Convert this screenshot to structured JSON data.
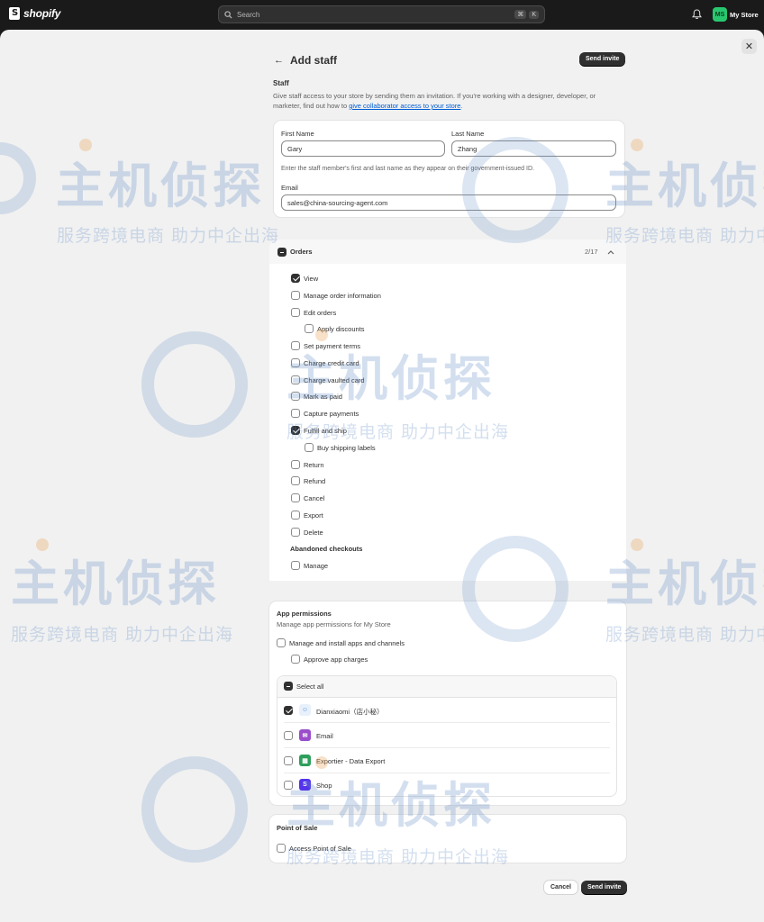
{
  "topbar": {
    "brand": "shopify",
    "search_placeholder": "Search",
    "shortcut_keys": [
      "⌘",
      "K"
    ],
    "avatar_initials": "MS",
    "store_name": "My Store",
    "avatar_color": "#28c76f"
  },
  "header": {
    "title": "Add staff",
    "send_invite": "Send invite"
  },
  "staff": {
    "title": "Staff",
    "desc_prefix": "Give staff access to your store by sending them an invitation. If you're working with a designer, developer, or marketer, find out how to ",
    "desc_link": "give collaborator access to your store",
    "desc_suffix": ".",
    "first_name_label": "First Name",
    "first_name_value": "Gary",
    "last_name_label": "Last Name",
    "last_name_value": "Zhang",
    "name_help": "Enter the staff member's first and last name as they appear on their government-issued ID.",
    "email_label": "Email",
    "email_value": "sales@china-sourcing-agent.com"
  },
  "orders": {
    "title": "Orders",
    "count": "2/17",
    "items": [
      {
        "label": "View",
        "checked": true
      },
      {
        "label": "Manage order information",
        "checked": false
      },
      {
        "label": "Edit orders",
        "checked": false
      },
      {
        "label": "Apply discounts",
        "checked": false
      },
      {
        "label": "Set payment terms",
        "checked": false
      },
      {
        "label": "Charge credit card",
        "checked": false
      },
      {
        "label": "Charge vaulted card",
        "checked": false
      },
      {
        "label": "Mark as paid",
        "checked": false
      },
      {
        "label": "Capture payments",
        "checked": false
      },
      {
        "label": "Fulfill and ship",
        "checked": true
      },
      {
        "label": "Buy shipping labels",
        "checked": false
      },
      {
        "label": "Return",
        "checked": false
      },
      {
        "label": "Refund",
        "checked": false
      },
      {
        "label": "Cancel",
        "checked": false
      },
      {
        "label": "Export",
        "checked": false
      },
      {
        "label": "Delete",
        "checked": false
      }
    ],
    "abandoned_title": "Abandoned checkouts",
    "abandoned_manage": "Manage"
  },
  "app_permissions": {
    "title": "App permissions",
    "subtitle": "Manage app permissions for My Store",
    "manage_install": "Manage and install apps and channels",
    "approve_charges": "Approve app charges",
    "select_all": "Select all",
    "apps": [
      {
        "name": "Dianxiaomi（店小秘）",
        "checked": true,
        "icon_color": "#e8f1fb",
        "icon": "person-icon"
      },
      {
        "name": "Email",
        "checked": false,
        "icon_color": "#9b4dca",
        "icon": "envelope-icon"
      },
      {
        "name": "Exportier - Data Export",
        "checked": false,
        "icon_color": "#2e9e5b",
        "icon": "storefront-icon"
      },
      {
        "name": "Shop",
        "checked": false,
        "icon_color": "#5433eb",
        "icon": "shop-icon"
      }
    ]
  },
  "point_of_sale": {
    "title": "Point of Sale",
    "access": "Access Point of Sale"
  },
  "footer": {
    "cancel": "Cancel",
    "send_invite": "Send invite"
  },
  "watermark": {
    "main": "主机侦探",
    "sub": "服务跨境电商 助力中企出海"
  }
}
